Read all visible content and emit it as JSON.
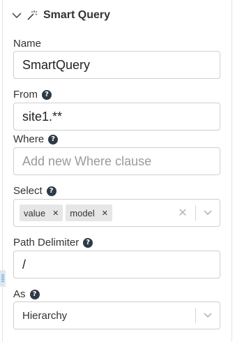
{
  "header": {
    "title": "Smart Query",
    "collapse_icon": "chevron-down-icon",
    "wand_icon": "magic-wand-icon"
  },
  "fields": {
    "name": {
      "label": "Name",
      "value": "SmartQuery"
    },
    "from": {
      "label": "From",
      "value": "site1.**"
    },
    "where": {
      "label": "Where",
      "placeholder": "Add new Where clause"
    },
    "select": {
      "label": "Select",
      "tags": [
        "value",
        "model"
      ]
    },
    "path_delimiter": {
      "label": "Path Delimiter",
      "value": "/"
    },
    "as": {
      "label": "As",
      "value": "Hierarchy"
    }
  },
  "help_glyph": "?",
  "colors": {
    "help_bg": "#2f3a47",
    "border": "#cfcfcf",
    "tag_bg": "#e6e6e6",
    "handle": "#d9e9f5"
  }
}
